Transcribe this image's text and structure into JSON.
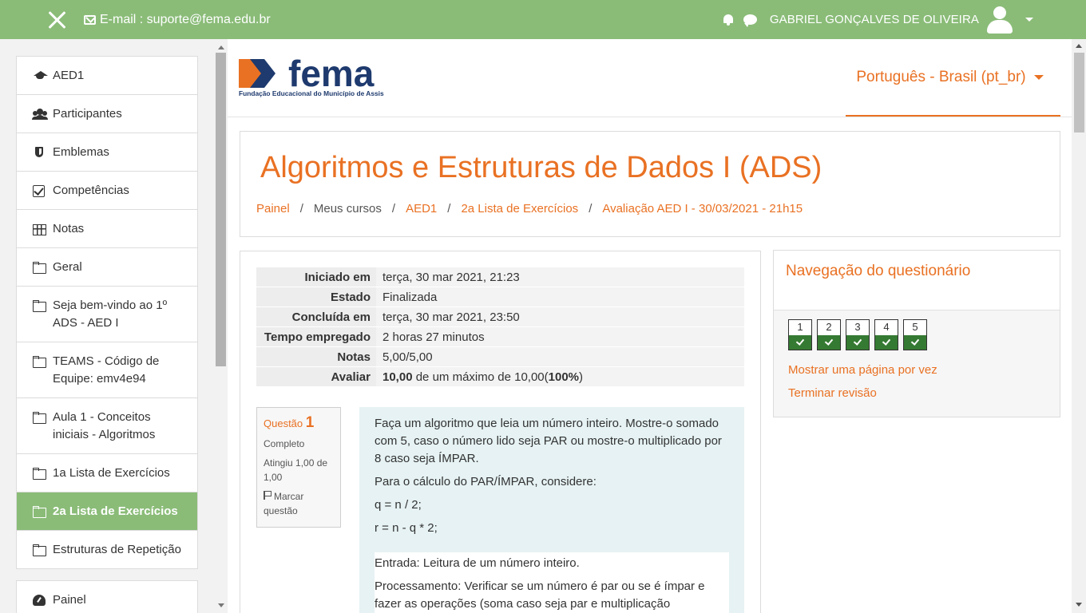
{
  "topbar": {
    "email_label": "E-mail : suporte@fema.edu.br",
    "user_name": "GABRIEL GONÇALVES DE OLIVEIRA"
  },
  "sidebar": {
    "items": [
      {
        "label": "AED1",
        "icon": "graduation-cap-icon"
      },
      {
        "label": "Participantes",
        "icon": "users-icon"
      },
      {
        "label": "Emblemas",
        "icon": "shield-icon"
      },
      {
        "label": "Competências",
        "icon": "checkbox-icon"
      },
      {
        "label": "Notas",
        "icon": "table-icon"
      },
      {
        "label": "Geral",
        "icon": "folder-icon"
      },
      {
        "label": "Seja bem-vindo ao 1º ADS - AED I",
        "icon": "folder-icon"
      },
      {
        "label": "TEAMS - Código de Equipe: emv4e94",
        "icon": "folder-icon"
      },
      {
        "label": "Aula 1 - Conceitos iniciais - Algoritmos",
        "icon": "folder-icon"
      },
      {
        "label": "1a Lista de Exercícios",
        "icon": "folder-icon"
      },
      {
        "label": "2a Lista de Exercícios",
        "icon": "folder-icon",
        "active": true
      },
      {
        "label": "Estruturas de Repetição",
        "icon": "folder-icon"
      }
    ],
    "dashboard_label": "Painel"
  },
  "logo": {
    "name": "fema",
    "subtitle": "Fundação Educacional do Município de Assis"
  },
  "language": {
    "selected": "Português - Brasil (pt_br)"
  },
  "course": {
    "title": "Algoritmos e Estruturas de Dados I (ADS)",
    "breadcrumb": [
      "Painel",
      "Meus cursos",
      "AED1",
      "2a Lista de Exercícios",
      "Avaliação AED I - 30/03/2021 - 21h15"
    ]
  },
  "summary": {
    "rows": [
      {
        "key": "Iniciado em",
        "value": "terça, 30 mar 2021, 21:23"
      },
      {
        "key": "Estado",
        "value": "Finalizada"
      },
      {
        "key": "Concluída em",
        "value": "terça, 30 mar 2021, 23:50"
      },
      {
        "key": "Tempo empregado",
        "value": "2 horas 27 minutos"
      },
      {
        "key": "Notas",
        "value": "5,00/5,00"
      }
    ],
    "grade_key": "Avaliar",
    "grade_value": "10,00",
    "grade_mid": " de um máximo de 10,00(",
    "grade_pct": "100%",
    "grade_end": ")"
  },
  "question": {
    "label": "Questão",
    "number": "1",
    "state": "Completo",
    "score": "Atingiu 1,00 de 1,00",
    "flag_label": "Marcar questão",
    "paragraphs": [
      "Faça um algoritmo que leia um número inteiro. Mostre-o somado com 5, caso o número lido seja PAR ou mostre-o multiplicado por 8 caso seja ÍMPAR.",
      "Para o cálculo do PAR/ÍMPAR, considere:",
      "q = n / 2;",
      "r = n - q * 2;"
    ],
    "inner": [
      "Entrada: Leitura de um número inteiro.",
      "Processamento: Verificar se um número é par ou se é ímpar e fazer as operações (soma caso seja par e multiplicação"
    ]
  },
  "quiz_nav": {
    "title": "Navegação do questionário",
    "buttons": [
      "1",
      "2",
      "3",
      "4",
      "5"
    ],
    "show_one_page": "Mostrar uma página por vez",
    "finish_review": "Terminar revisão"
  },
  "colors": {
    "accent": "#e97123",
    "topbar": "#8abc78",
    "correct": "#357a32"
  }
}
